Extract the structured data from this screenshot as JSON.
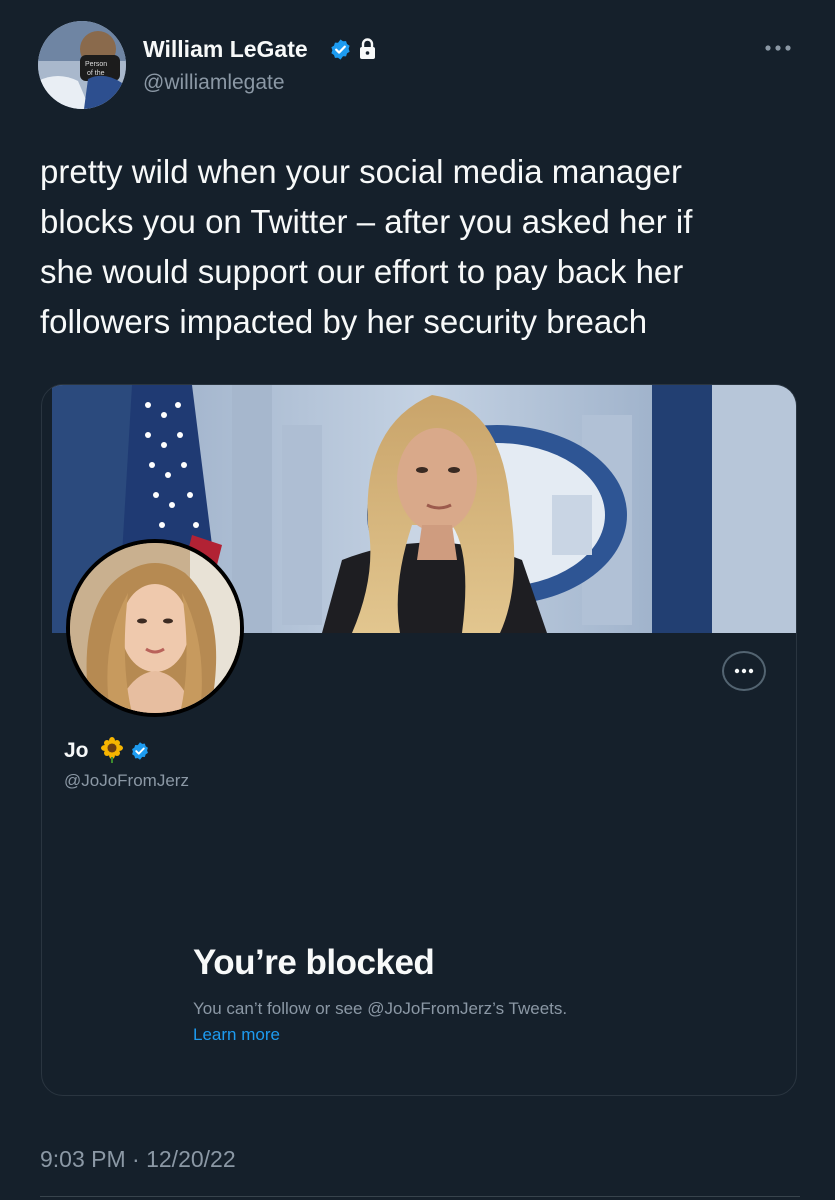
{
  "tweet": {
    "author_name": "William LeGate",
    "author_handle": "@williamlegate",
    "text_lines": [
      "pretty wild when your social media manager",
      "blocks you on Twitter – after you asked her if",
      "she would support our effort to pay back her",
      "followers impacted by her security breach"
    ],
    "timestamp": "9:03 PM · 12/20/22"
  },
  "embedded_profile": {
    "name": "Jo",
    "handle": "@JoJoFromJerz",
    "blocked_title": "You’re blocked",
    "blocked_message": "You can’t follow or see @JoJoFromJerz’s Tweets.",
    "learn_more": "Learn more"
  },
  "icons": {
    "verified": "verified-badge-icon",
    "lock": "lock-icon",
    "more": "more-horizontal-icon",
    "sunflower": "sunflower-emoji-icon"
  },
  "colors": {
    "background": "#15202b",
    "text": "#f7f9f9",
    "secondary": "#8b98a5",
    "accent": "#1d9bf0"
  }
}
